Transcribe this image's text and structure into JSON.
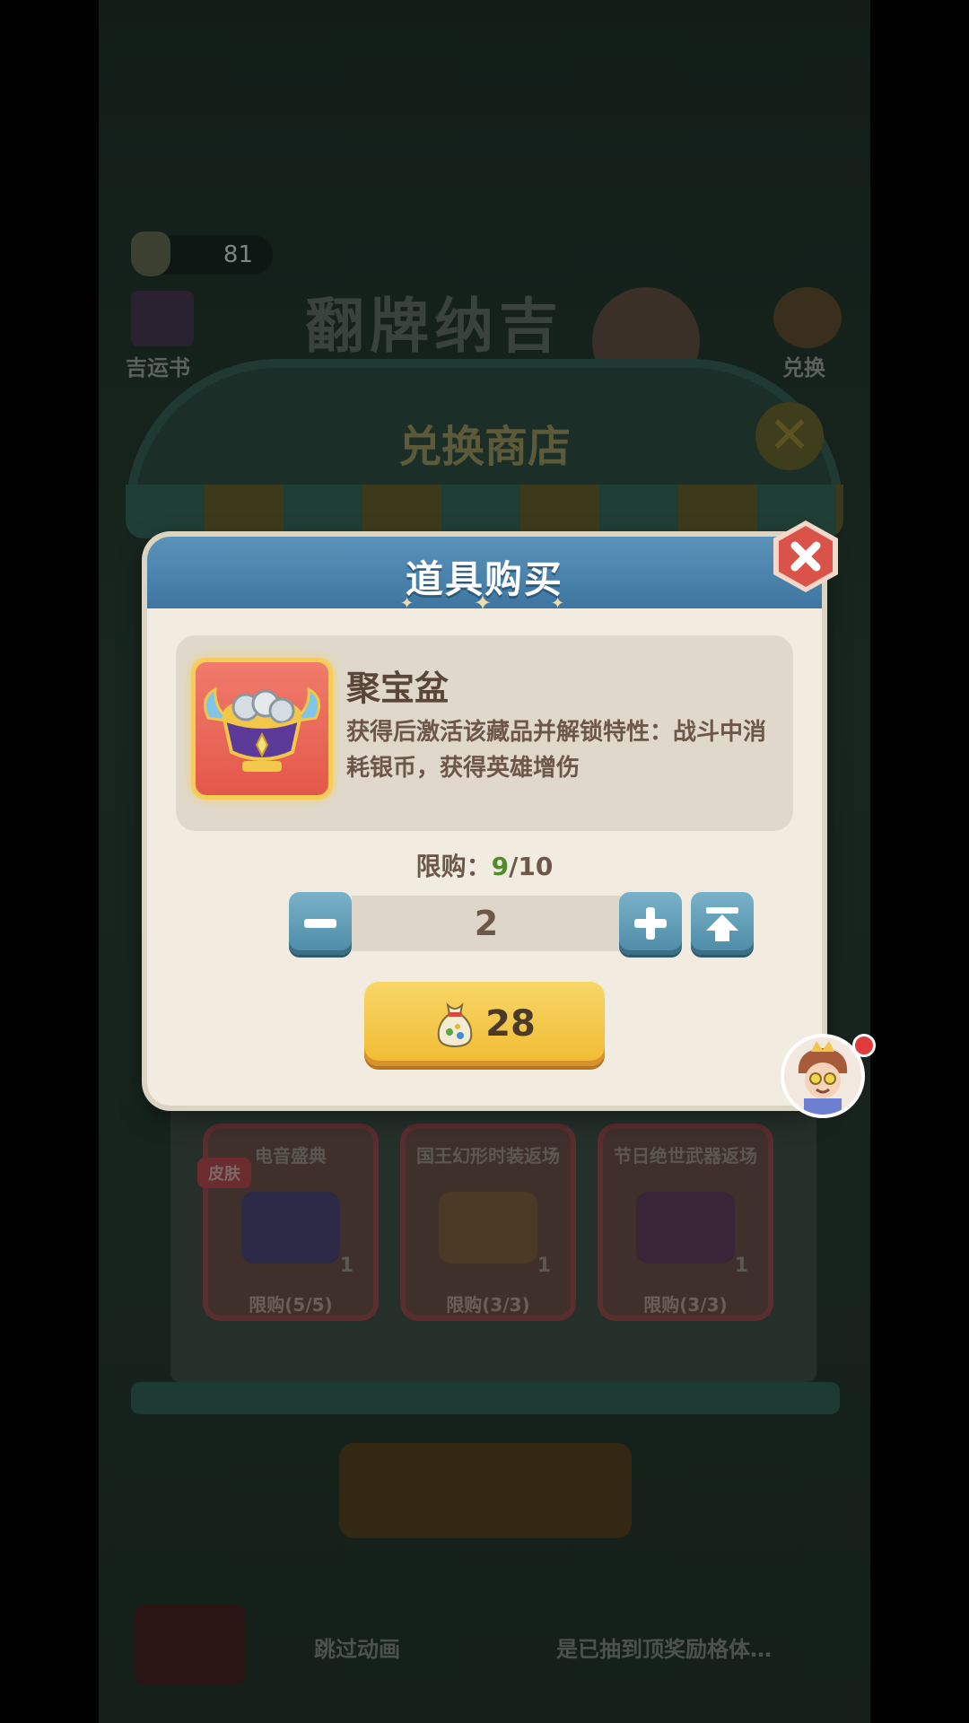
{
  "background": {
    "currency_amount": "81",
    "left_label": "吉运书",
    "right_label": "兑换",
    "event_banner": "翻牌纳吉",
    "shop_title": "兑换商店",
    "cards": [
      {
        "title": "电音盛典",
        "count": "1",
        "limit": "限购(5/5)",
        "tag": "皮肤",
        "art_color": "#2d2a48"
      },
      {
        "title": "国王幻形时装返场",
        "count": "1",
        "limit": "限购(3/3)",
        "tag": "",
        "art_color": "#4a3a25"
      },
      {
        "title": "节日绝世武器返场",
        "count": "1",
        "limit": "限购(3/3)",
        "tag": "",
        "art_color": "#3a2438"
      }
    ],
    "bottom_skip_label": "跳过动画",
    "bottom_hint": "是已抽到顶奖励格体…"
  },
  "dialog": {
    "title": "道具购买",
    "close_icon": "close-icon"
  },
  "item": {
    "name": "聚宝盆",
    "description": "获得后激活该藏品并解锁特性：战斗中消耗银币，获得英雄增伤",
    "icon": "treasure-bowl-icon"
  },
  "purchase_limit": {
    "label": "限购：",
    "current": "9",
    "separator": "/",
    "max": "10"
  },
  "quantity": {
    "value": "2",
    "decrease_icon": "minus-icon",
    "increase_icon": "plus-icon",
    "max_icon": "max-arrow-icon"
  },
  "buy_button": {
    "price": "28",
    "currency_icon": "money-bag-icon"
  },
  "colors": {
    "header_blue": "#4a83ad",
    "limit_green": "#4e8d2c",
    "buy_yellow": "#f3c341",
    "close_red": "#d9534a"
  }
}
